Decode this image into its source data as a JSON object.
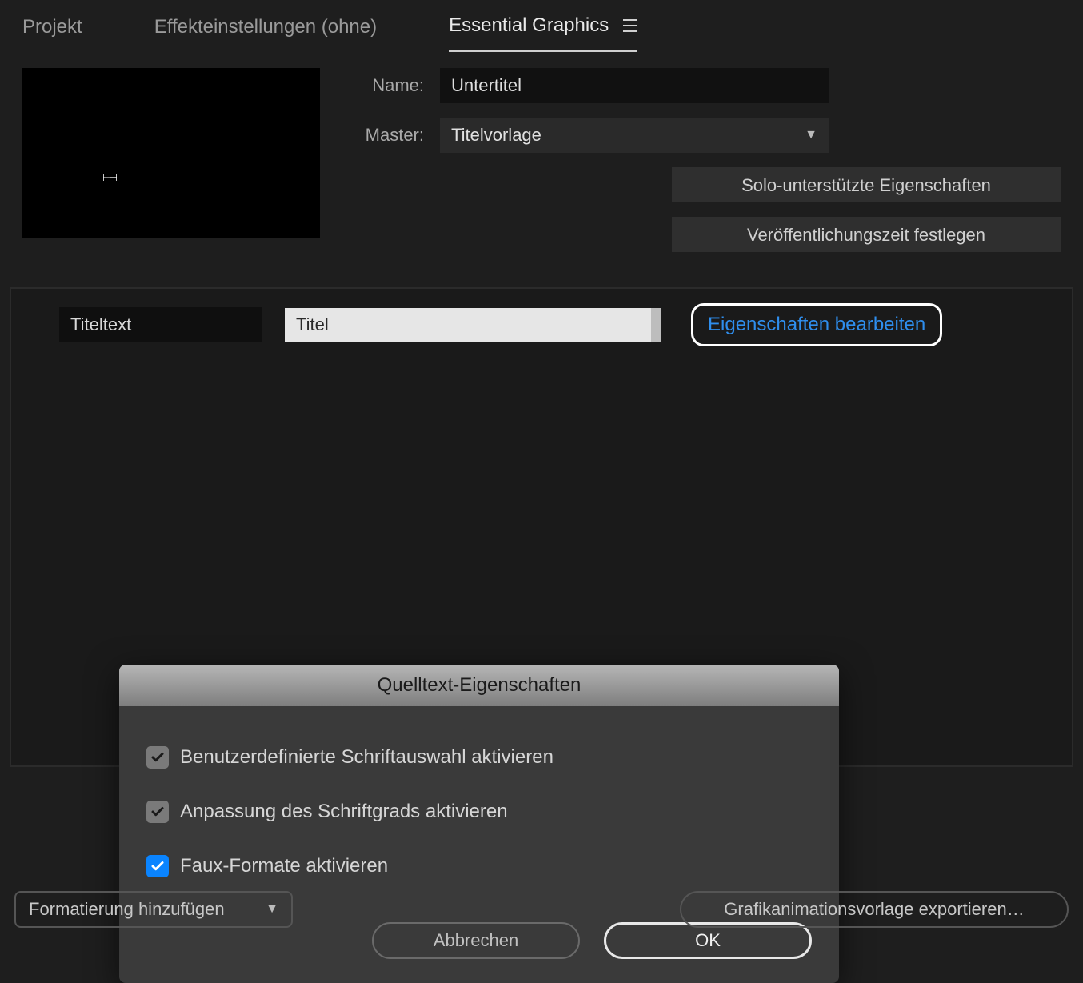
{
  "tabs": {
    "project": "Projekt",
    "effect": "Effekteinstellungen (ohne)",
    "egp": "Essential Graphics"
  },
  "header": {
    "name_label": "Name:",
    "name_value": "Untertitel",
    "master_label": "Master:",
    "master_value": "Titelvorlage",
    "solo_btn": "Solo-unterstützte Eigenschaften",
    "poster_btn": "Veröffentlichungszeit festlegen"
  },
  "prop": {
    "label": "Titeltext",
    "value": "Titel",
    "edit": "Eigenschaften bearbeiten"
  },
  "dialog": {
    "title": "Quelltext-Eigenschaften",
    "opt1": "Benutzerdefinierte Schriftauswahl aktivieren",
    "opt2": "Anpassung des Schriftgrads aktivieren",
    "opt3": "Faux-Formate aktivieren",
    "cancel": "Abbrechen",
    "ok": "OK"
  },
  "footer": {
    "add": "Formatierung hinzufügen",
    "export": "Grafikanimationsvorlage exportieren…"
  }
}
